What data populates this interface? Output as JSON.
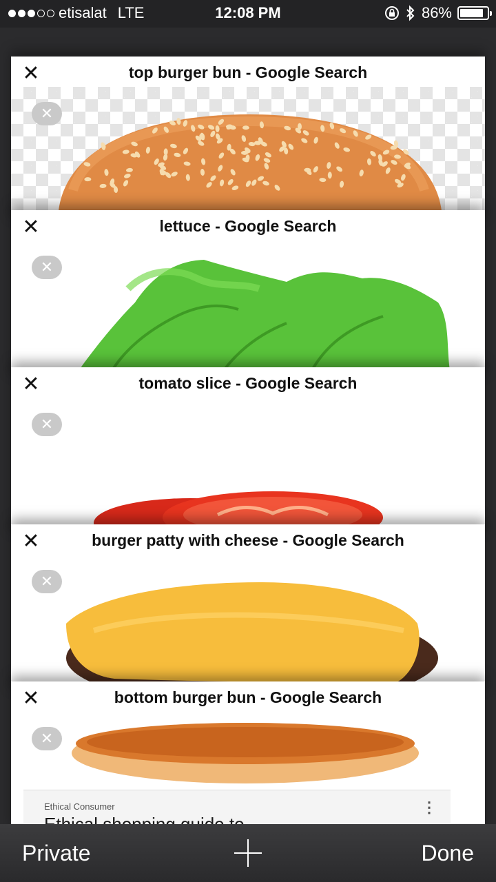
{
  "status_bar": {
    "carrier": "etisalat",
    "network": "LTE",
    "time": "12:08 PM",
    "battery": "86%",
    "battery_level": 0.86,
    "signal_bars_filled": 3,
    "signal_bars_total": 5,
    "icons": [
      "rotation-lock-icon",
      "bluetooth-icon",
      "battery-icon"
    ]
  },
  "tabs": [
    {
      "title": "top burger bun - Google Search",
      "close_glyph": "✕",
      "preview": "top-burger-bun-image"
    },
    {
      "title": "lettuce - Google Search",
      "close_glyph": "✕",
      "preview": "lettuce-image"
    },
    {
      "title": "tomato slice - Google Search",
      "close_glyph": "✕",
      "preview": "tomato-slice-image"
    },
    {
      "title": "burger patty with cheese - Google Search",
      "close_glyph": "✕",
      "preview": "burger-patty-cheese-image"
    },
    {
      "title": "bottom burger bun - Google Search",
      "close_glyph": "✕",
      "preview": "bottom-burger-bun-image",
      "snippet": {
        "source": "Ethical Consumer",
        "headline": "Ethical shopping guide to"
      }
    }
  ],
  "toolbar": {
    "private_label": "Private",
    "done_label": "Done",
    "add_icon": "plus-icon"
  },
  "colors": {
    "background": "#2b2b2d",
    "toolbar": "#333335",
    "bun": "#e08a45",
    "lettuce": "#5ec63a",
    "tomato": "#e8341f",
    "cheese": "#f7bd3c",
    "patty": "#4a2a1c"
  }
}
